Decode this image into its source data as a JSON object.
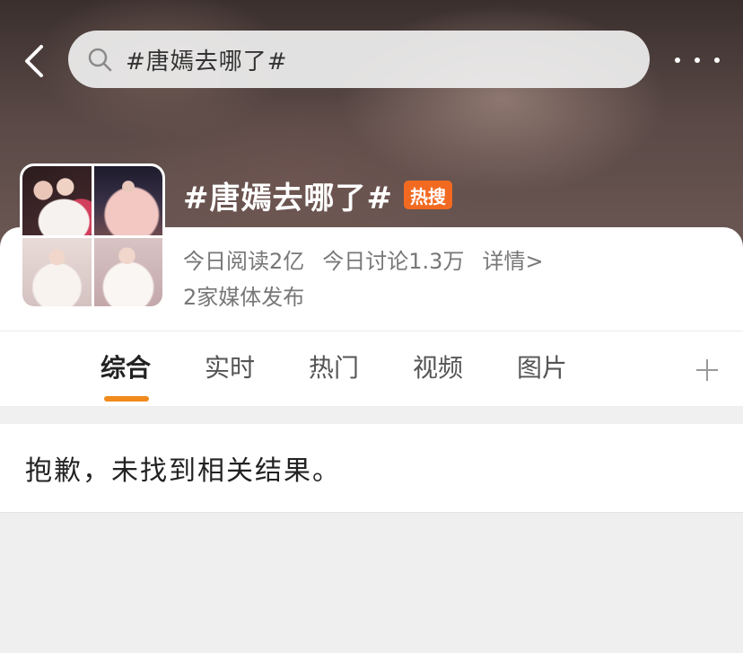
{
  "header": {
    "search_query": "#唐嫣去哪了#",
    "back_icon": "chevron-left-icon",
    "more_icon": "more-dots-icon",
    "search_icon": "search-icon"
  },
  "topic": {
    "title": "#唐嫣去哪了#",
    "badge": "热搜",
    "badge_color": "#f26a21",
    "stats": {
      "reads": "今日阅读2亿",
      "discussions": "今日讨论1.3万",
      "details": "详情>"
    },
    "media": "2家媒体发布"
  },
  "tabs": {
    "items": [
      {
        "label": "综合"
      },
      {
        "label": "实时"
      },
      {
        "label": "热门"
      },
      {
        "label": "视频"
      },
      {
        "label": "图片"
      }
    ],
    "active_index": 0,
    "accent_color": "#f08a1c",
    "add_icon": "plus-icon"
  },
  "result": {
    "message": "抱歉，未找到相关结果。"
  }
}
